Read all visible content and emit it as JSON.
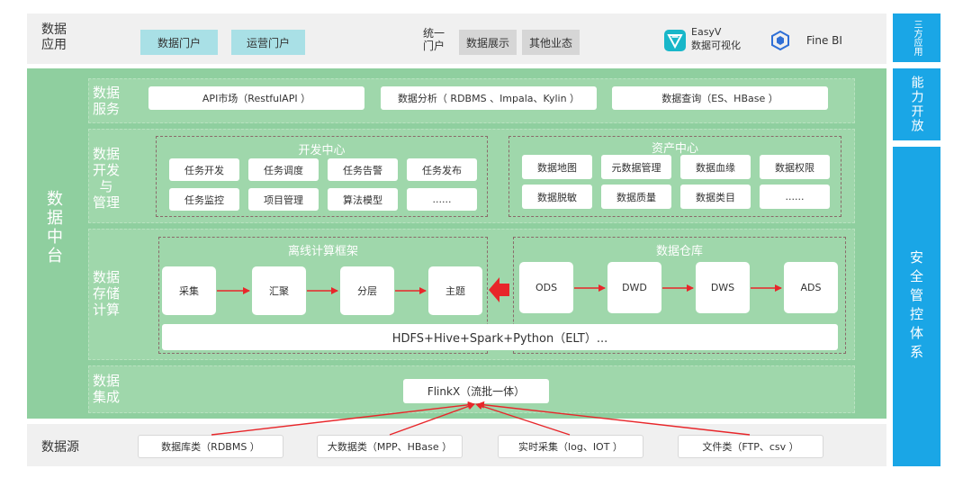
{
  "top": {
    "label": "数据\n应用",
    "portals": [
      "数据门户",
      "运营门户"
    ],
    "unified_label": "统一\n门户",
    "unified_items": [
      "数据展示",
      "其他业态"
    ],
    "easyv": {
      "line1": "EasyV",
      "line2": "数据可视化"
    },
    "finebi": "Fine BI"
  },
  "center": {
    "title": "数\n据\n中\n台",
    "service": {
      "label": "数据\n服务",
      "items": [
        "API市场（RestfulAPI ）",
        "数据分析（ RDBMS 、Impala、Kylin ）",
        "数据查询（ES、HBase ）"
      ]
    },
    "dev": {
      "label": "数据\n开发\n与\n管理",
      "dev_center": {
        "title": "开发中心",
        "row1": [
          "任务开发",
          "任务调度",
          "任务告警",
          "任务发布"
        ],
        "row2": [
          "任务监控",
          "项目管理",
          "算法模型",
          "......"
        ]
      },
      "asset_center": {
        "title": "资产中心",
        "row1": [
          "数据地图",
          "元数据管理",
          "数据血缘",
          "数据权限"
        ],
        "row2": [
          "数据脱敏",
          "数据质量",
          "数据类目",
          "......"
        ]
      }
    },
    "storage": {
      "label": "数据\n存储\n计算",
      "offline": {
        "title": "离线计算框架",
        "stages": [
          "采集",
          "汇聚",
          "分层",
          "主题"
        ]
      },
      "warehouse": {
        "title": "数据仓库",
        "stages": [
          "ODS",
          "DWD",
          "DWS",
          "ADS"
        ]
      },
      "engine": "HDFS+Hive+Spark+Python（ELT）..."
    },
    "integration": {
      "label": "数据\n集成",
      "flinkx": "FlinkX（流批一体）"
    }
  },
  "bottom": {
    "label": "数据源",
    "sources": [
      "数据库类（RDBMS ）",
      "大数据类（MPP、HBase ）",
      "实时采集（log、IOT ）",
      "文件类（FTP、csv ）"
    ]
  },
  "side": {
    "third_party": "三方应用",
    "capability": "能力开放",
    "security": "安全管控体系"
  },
  "colors": {
    "green": "#8fcf9f",
    "blue": "#1aa6e6",
    "teal": "#a9e0e6",
    "arrow": "#e8262a"
  }
}
